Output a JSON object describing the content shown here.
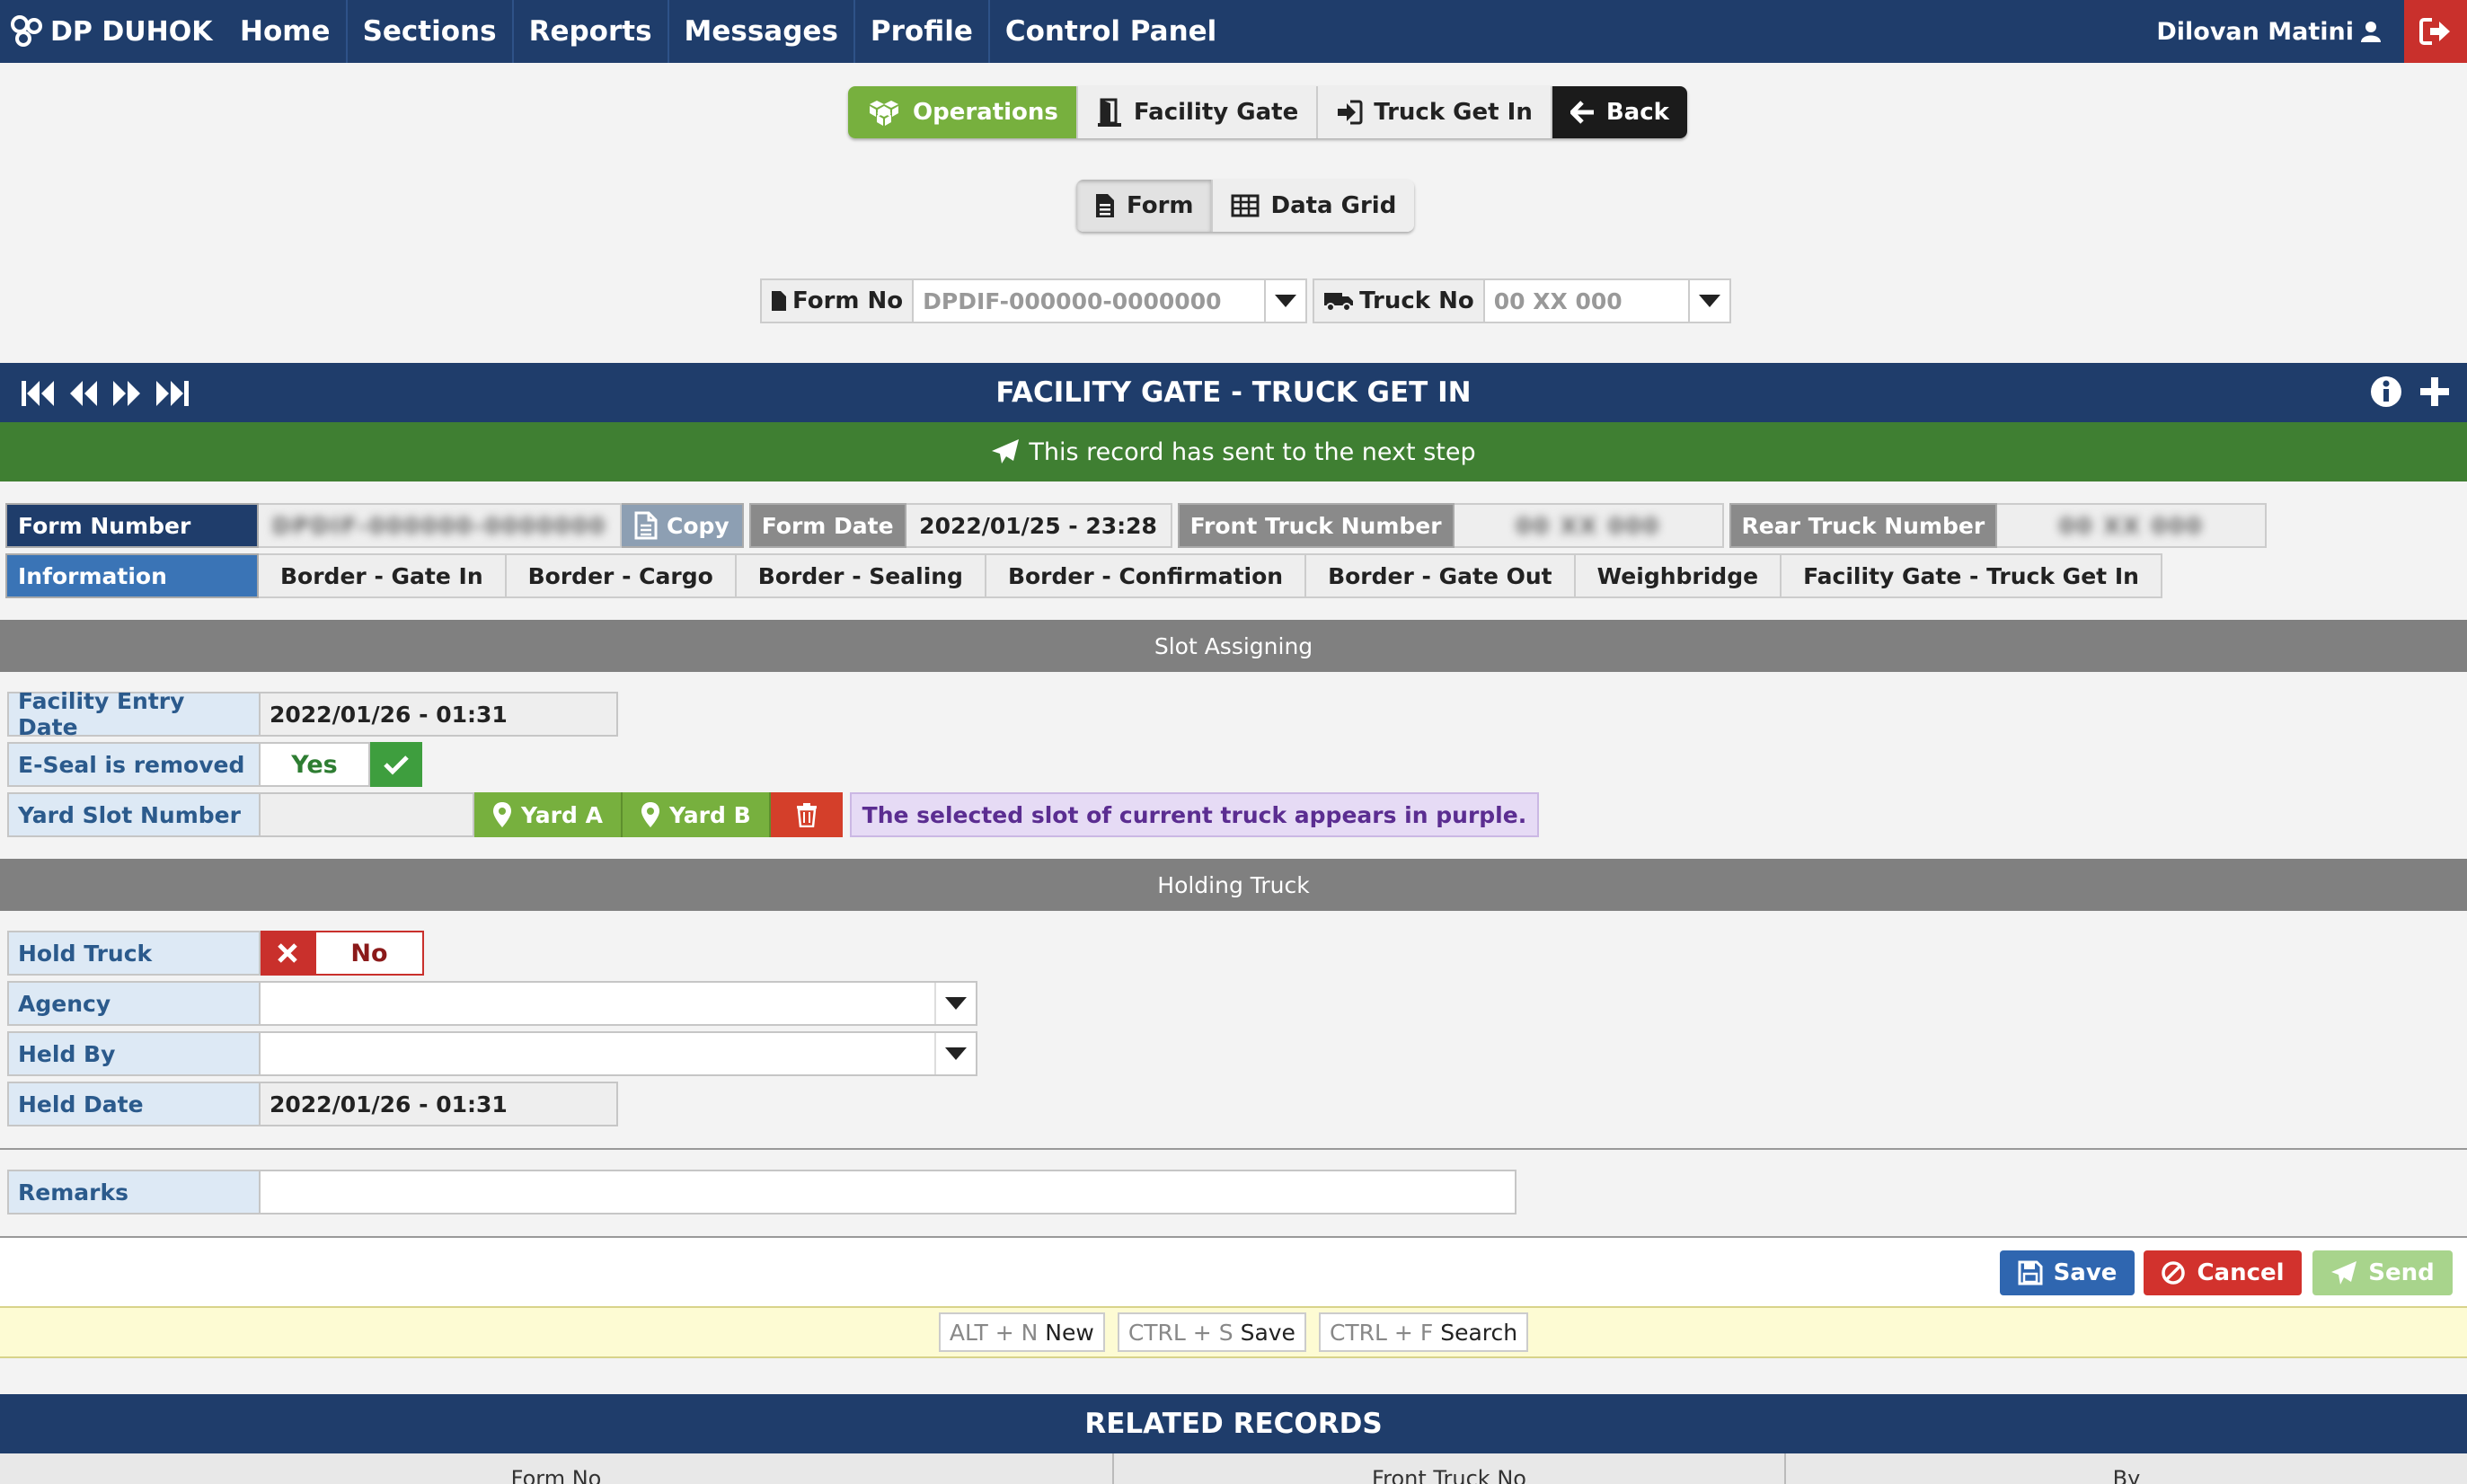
{
  "brand": {
    "name": "DP DUHOK"
  },
  "nav": {
    "items": [
      "Home",
      "Sections",
      "Reports",
      "Messages",
      "Profile",
      "Control Panel"
    ]
  },
  "user": {
    "name": "Dilovan Matini"
  },
  "breadcrumb": {
    "operations": "Operations",
    "facility_gate": "Facility Gate",
    "truck_get_in": "Truck Get In",
    "back": "Back"
  },
  "view_toggle": {
    "form": "Form",
    "data_grid": "Data Grid"
  },
  "search": {
    "form_no_label": "Form No",
    "form_no_placeholder": "DPDIF-000000-0000000",
    "truck_no_label": "Truck No",
    "truck_no_placeholder": "00 XX 000"
  },
  "panel": {
    "title": "FACILITY GATE - TRUCK GET IN",
    "sent_message": "This record has sent to the next step"
  },
  "record": {
    "form_number_label": "Form Number",
    "form_number_value": "DPDIF-000000-0000000",
    "copy_label": "Copy",
    "form_date_label": "Form Date",
    "form_date_value": "2022/01/25 - 23:28",
    "front_truck_label": "Front Truck Number",
    "front_truck_value": "00 XX 000",
    "rear_truck_label": "Rear Truck Number",
    "rear_truck_value": "00 XX 000"
  },
  "tabs": {
    "information": "Information",
    "items": [
      "Border - Gate In",
      "Border - Cargo",
      "Border - Sealing",
      "Border - Confirmation",
      "Border - Gate Out",
      "Weighbridge",
      "Facility Gate - Truck Get In"
    ]
  },
  "slot_section": {
    "title": "Slot Assigning",
    "entry_date_label": "Facility Entry Date",
    "entry_date_value": "2022/01/26 - 01:31",
    "eseal_label": "E-Seal is removed",
    "eseal_value": "Yes",
    "yard_slot_label": "Yard Slot Number",
    "yard_a": "Yard A",
    "yard_b": "Yard B",
    "note": "The selected slot of current truck appears in purple."
  },
  "hold_section": {
    "title": "Holding Truck",
    "hold_label": "Hold Truck",
    "hold_value": "No",
    "agency_label": "Agency",
    "held_by_label": "Held By",
    "held_date_label": "Held Date",
    "held_date_value": "2022/01/26 - 01:31"
  },
  "remarks": {
    "label": "Remarks"
  },
  "actions": {
    "save": "Save",
    "cancel": "Cancel",
    "send": "Send"
  },
  "shortcuts": [
    {
      "keys": "ALT + N",
      "label": "New"
    },
    {
      "keys": "CTRL + S",
      "label": "Save"
    },
    {
      "keys": "CTRL + F",
      "label": "Search"
    }
  ],
  "related": {
    "title": "RELATED RECORDS",
    "columns": [
      "Form No",
      "Front Truck No",
      "By"
    ]
  },
  "colors": {
    "navy": "#1f3d6b",
    "green": "#77b03e",
    "sent_green": "#3f7f32",
    "red": "#c9302c",
    "blue": "#3a74b6",
    "purple_text": "#5b2d91"
  }
}
